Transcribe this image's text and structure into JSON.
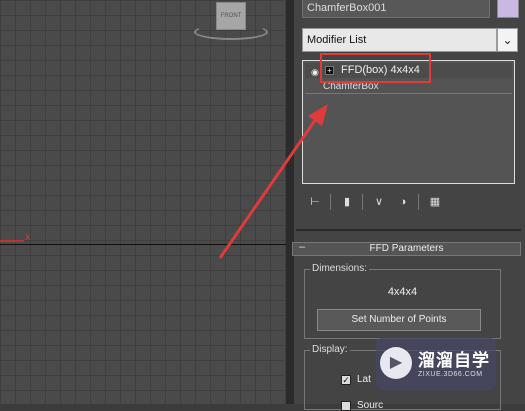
{
  "viewport": {
    "axis_label": "X",
    "viewcube_label": "FRONT"
  },
  "panel": {
    "object_name": "ChamferBox001",
    "color_swatch": "#c9b9e2",
    "modifier_list": {
      "label": "Modifier List",
      "dropdown_icon": "chevron-down-icon"
    },
    "stack": {
      "items": [
        {
          "label": "FFD(box) 4x4x4",
          "icon": "lightbulb-icon",
          "expand": "+"
        },
        {
          "label": "ChamferBox"
        }
      ]
    },
    "toolbar": {
      "icons": [
        "pin-stack-icon",
        "show-end-result-icon",
        "make-unique-icon",
        "remove-modifier-icon",
        "configure-modifier-sets-icon"
      ]
    },
    "ffd_parameters": {
      "title": "FFD Parameters",
      "collapse": "–",
      "dimensions": {
        "label": "Dimensions:",
        "value": "4x4x4",
        "button": "Set Number of Points"
      },
      "display": {
        "label": "Display:",
        "checkbox1": {
          "label": "Lat",
          "checked": true
        },
        "checkbox2": {
          "label": "Sourc",
          "checked": false
        }
      }
    }
  },
  "annotation": {
    "color": "#e03a3a"
  },
  "watermark": {
    "title": "溜溜自学",
    "url": "ZIXUE.3D66.COM",
    "logo": "play-logo-icon"
  }
}
